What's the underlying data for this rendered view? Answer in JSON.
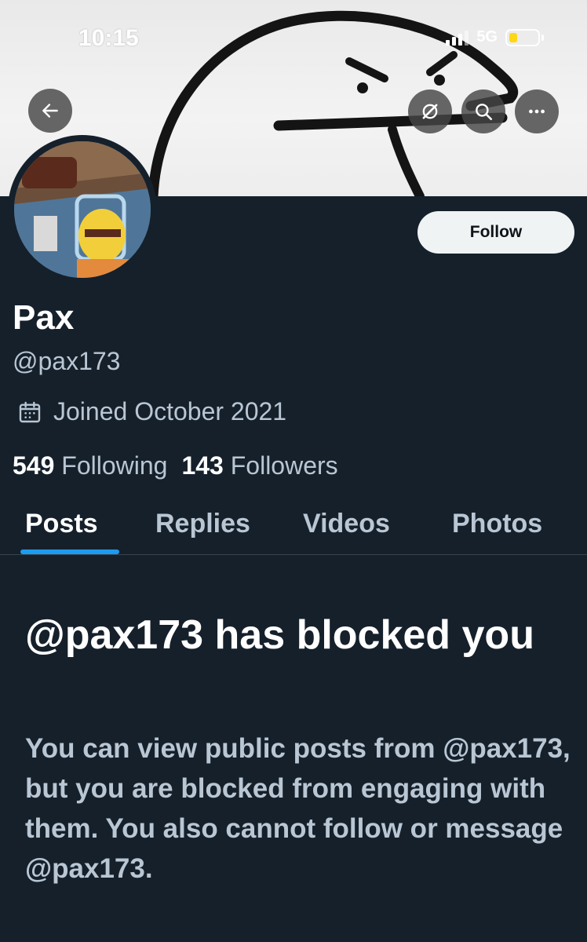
{
  "status_bar": {
    "time": "10:15",
    "network": "5G",
    "network_icon": "signal-bars-icon",
    "battery_color": "#ffd60a"
  },
  "header": {
    "back_icon": "back-arrow-icon",
    "unmute_icon": "unmute-icon",
    "search_icon": "search-icon",
    "more_icon": "more-dots-icon"
  },
  "profile": {
    "name": "Pax",
    "handle": "@pax173",
    "joined": "Joined October 2021",
    "joined_icon": "calendar-icon",
    "following_count": "549",
    "following_label": "Following",
    "followers_count": "143",
    "followers_label": "Followers",
    "follow_button": "Follow"
  },
  "tabs": [
    {
      "label": "Posts",
      "active": true
    },
    {
      "label": "Replies",
      "active": false
    },
    {
      "label": "Videos",
      "active": false
    },
    {
      "label": "Photos",
      "active": false
    }
  ],
  "blocked": {
    "title": "@pax173 has blocked you",
    "description": "You can view public posts from @pax173, but you are blocked from engaging with them. You also cannot follow or message @pax173."
  },
  "colors": {
    "background": "#15202b",
    "accent": "#1d9bf0",
    "secondary_text": "#b9c6d3"
  }
}
